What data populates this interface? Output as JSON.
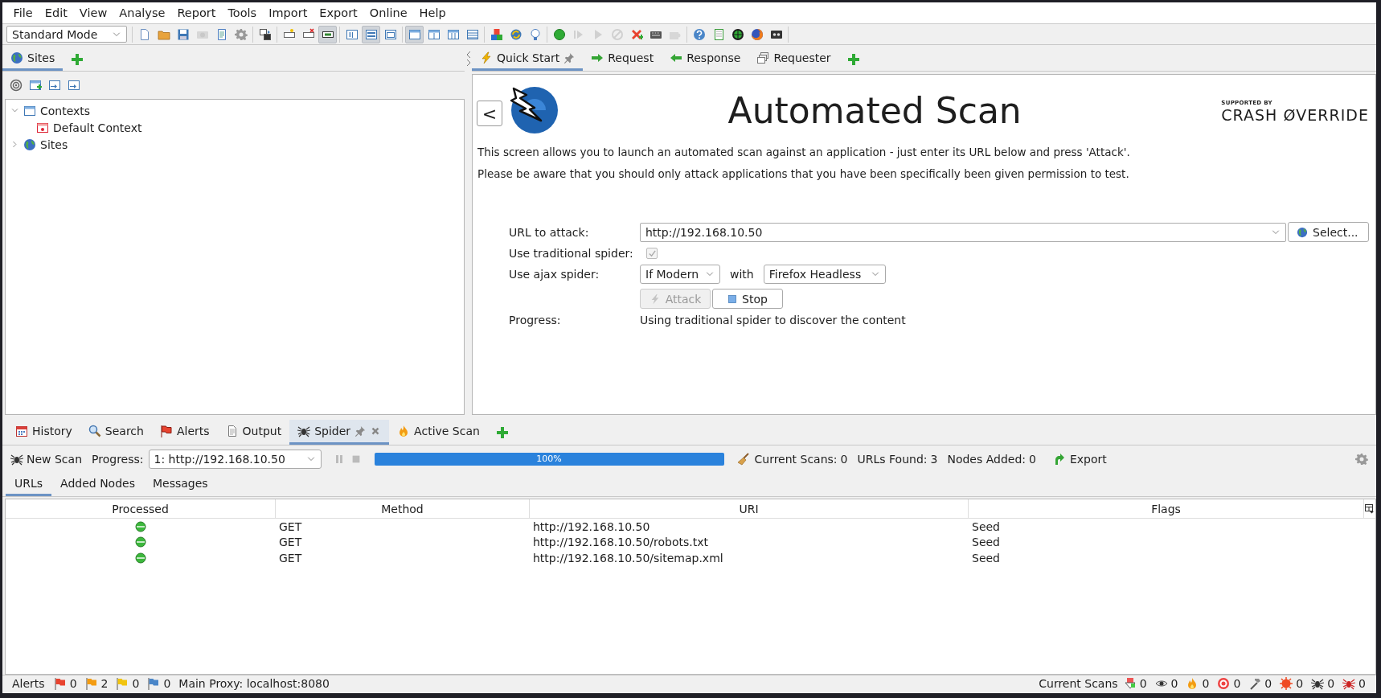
{
  "menu": [
    "File",
    "Edit",
    "View",
    "Analyse",
    "Report",
    "Tools",
    "Import",
    "Export",
    "Online",
    "Help"
  ],
  "toolbar": {
    "mode": "Standard Mode",
    "buttons": [
      {
        "pressed": false,
        "disabled": false
      },
      {
        "pressed": false,
        "disabled": false
      },
      {
        "pressed": false,
        "disabled": false
      },
      {
        "pressed": false,
        "disabled": true
      },
      {
        "pressed": false,
        "disabled": false
      },
      {
        "pressed": false,
        "disabled": false
      },
      {
        "pressed": false,
        "disabled": false
      },
      {
        "pressed": false,
        "disabled": false
      },
      {
        "pressed": false,
        "disabled": false
      },
      {
        "pressed": true,
        "disabled": false
      },
      {
        "pressed": false,
        "disabled": false
      },
      {
        "pressed": true,
        "disabled": false
      },
      {
        "pressed": false,
        "disabled": false
      },
      {
        "pressed": true,
        "disabled": false
      },
      {
        "pressed": false,
        "disabled": false
      },
      {
        "pressed": false,
        "disabled": false
      },
      {
        "pressed": false,
        "disabled": false
      },
      {
        "pressed": false,
        "disabled": false
      },
      {
        "pressed": false,
        "disabled": false
      },
      {
        "pressed": false,
        "disabled": false
      },
      {
        "pressed": false,
        "disabled": false
      },
      {
        "pressed": false,
        "disabled": true
      },
      {
        "pressed": false,
        "disabled": true
      },
      {
        "pressed": false,
        "disabled": true
      },
      {
        "pressed": false,
        "disabled": false
      },
      {
        "pressed": false,
        "disabled": false
      },
      {
        "pressed": false,
        "disabled": true
      },
      {
        "pressed": false,
        "disabled": false
      },
      {
        "pressed": false,
        "disabled": false
      },
      {
        "pressed": false,
        "disabled": false
      },
      {
        "pressed": false,
        "disabled": false
      },
      {
        "pressed": false,
        "disabled": false
      }
    ]
  },
  "sites_pane": {
    "tabs": [
      {
        "label": "Sites",
        "selected": true
      }
    ],
    "tree": [
      {
        "label": "Contexts",
        "expanded": true,
        "children": [
          {
            "label": "Default Context"
          }
        ]
      },
      {
        "label": "Sites",
        "expanded": false
      }
    ]
  },
  "work_pane": {
    "tabs": [
      {
        "label": "Quick Start",
        "selected": true,
        "pinned": true
      },
      {
        "label": "Request",
        "selected": false,
        "pinned": false
      },
      {
        "label": "Response",
        "selected": false,
        "pinned": false
      },
      {
        "label": "Requester",
        "selected": false,
        "pinned": false
      }
    ],
    "quick_start": {
      "back": "<",
      "title": "Automated Scan",
      "sponsor_caption": "SUPPORTED BY",
      "sponsor_name": "CRASH ØVERRIDE",
      "paragraphs": [
        "This screen allows you to launch an automated scan against  an application - just enter its URL below and press 'Attack'.",
        "Please be aware that you should only attack applications that you have been specifically been given permission to test."
      ],
      "url_label": "URL to attack:",
      "url_value": "http://192.168.10.50",
      "select_button": "Select...",
      "traditional_label": "Use traditional spider:",
      "traditional_checked": true,
      "traditional_disabled": true,
      "ajax_label": "Use ajax spider:",
      "ajax_mode": "If Modern",
      "with": "with",
      "browser": "Firefox Headless",
      "attack": {
        "label": "Attack",
        "disabled": true
      },
      "stop": {
        "label": "Stop",
        "disabled": false
      },
      "progress_label": "Progress:",
      "progress_text": "Using traditional spider to discover the content"
    }
  },
  "bottom_pane": {
    "tabs": [
      {
        "label": "History",
        "selected": false,
        "pinned": false,
        "closable": false
      },
      {
        "label": "Search",
        "selected": false,
        "pinned": false,
        "closable": false
      },
      {
        "label": "Alerts",
        "selected": false,
        "pinned": false,
        "closable": false
      },
      {
        "label": "Output",
        "selected": false,
        "pinned": false,
        "closable": false
      },
      {
        "label": "Spider",
        "selected": true,
        "pinned": true,
        "closable": true
      },
      {
        "label": "Active Scan",
        "selected": false,
        "pinned": false,
        "closable": false
      }
    ],
    "spider": {
      "new_scan": "New Scan",
      "progress_label": "Progress:",
      "scan": "1: http://192.168.10.50",
      "level": 1,
      "percent": "100%",
      "stats": [
        {
          "label": "Current Scans:",
          "value": "0"
        },
        {
          "label": "URLs Found:",
          "value": "3"
        },
        {
          "label": "Nodes Added:",
          "value": "0"
        }
      ],
      "export": "Export",
      "subtabs": [
        {
          "label": "URLs",
          "selected": true
        },
        {
          "label": "Added Nodes",
          "selected": false
        },
        {
          "label": "Messages",
          "selected": false
        }
      ],
      "columns": [
        "Processed",
        "Method",
        "URI",
        "Flags"
      ],
      "rows": [
        {
          "processed": true,
          "method": "GET",
          "uri": "http://192.168.10.50",
          "flags": "Seed"
        },
        {
          "processed": true,
          "method": "GET",
          "uri": "http://192.168.10.50/robots.txt",
          "flags": "Seed"
        },
        {
          "processed": true,
          "method": "GET",
          "uri": "http://192.168.10.50/sitemap.xml",
          "flags": "Seed"
        }
      ]
    }
  },
  "status_bar": {
    "alerts_label": "Alerts",
    "alert_counts": [
      {
        "color": "#e8432f",
        "count": "0"
      },
      {
        "color": "#f39c12",
        "count": "2"
      },
      {
        "color": "#f1c40f",
        "count": "0"
      },
      {
        "color": "#4a86c8",
        "count": "0"
      }
    ],
    "proxy": "Main Proxy: localhost:8080",
    "scans_label": "Current Scans",
    "scan_counts": [
      "0",
      "0",
      "0",
      "0",
      "0",
      "0",
      "0",
      "0"
    ]
  }
}
